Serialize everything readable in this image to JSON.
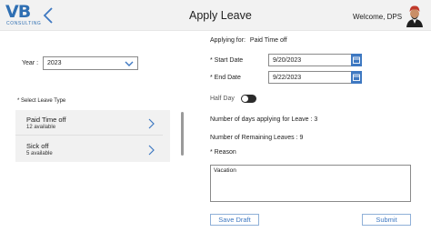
{
  "header": {
    "logo_main": "VB",
    "logo_sub": "CONSULTING",
    "title": "Apply Leave",
    "welcome": "Welcome, DPS"
  },
  "colors": {
    "brand_blue": "#2f6fb3",
    "accent_blue": "#3e78c1",
    "header_bg": "#f2f2f2",
    "list_bg": "#f1f1f1",
    "toggle_off": "#2b2b2b"
  },
  "year": {
    "label": "Year :",
    "value": "2023"
  },
  "leave_types": {
    "label": "* Select Leave Type",
    "items": [
      {
        "name": "Paid Time off",
        "available": "12 available"
      },
      {
        "name": "Sick off",
        "available": "5 available"
      }
    ]
  },
  "form": {
    "applying_for_label": "Applying for:",
    "applying_for_value": "Paid Time off",
    "start_date_label": "* Start Date",
    "start_date_value": "9/20/2023",
    "end_date_label": "* End Date",
    "end_date_value": "9/22/2023",
    "half_day_label": "Half Day",
    "half_day_on": false,
    "days_applying": "Number of days applying for Leave : 3",
    "remaining_leaves": "Number of Remaining Leaves : 9",
    "reason_label": "* Reason",
    "reason_value": "Vacation"
  },
  "actions": {
    "save_draft": "Save Draft",
    "submit": "Submit"
  }
}
